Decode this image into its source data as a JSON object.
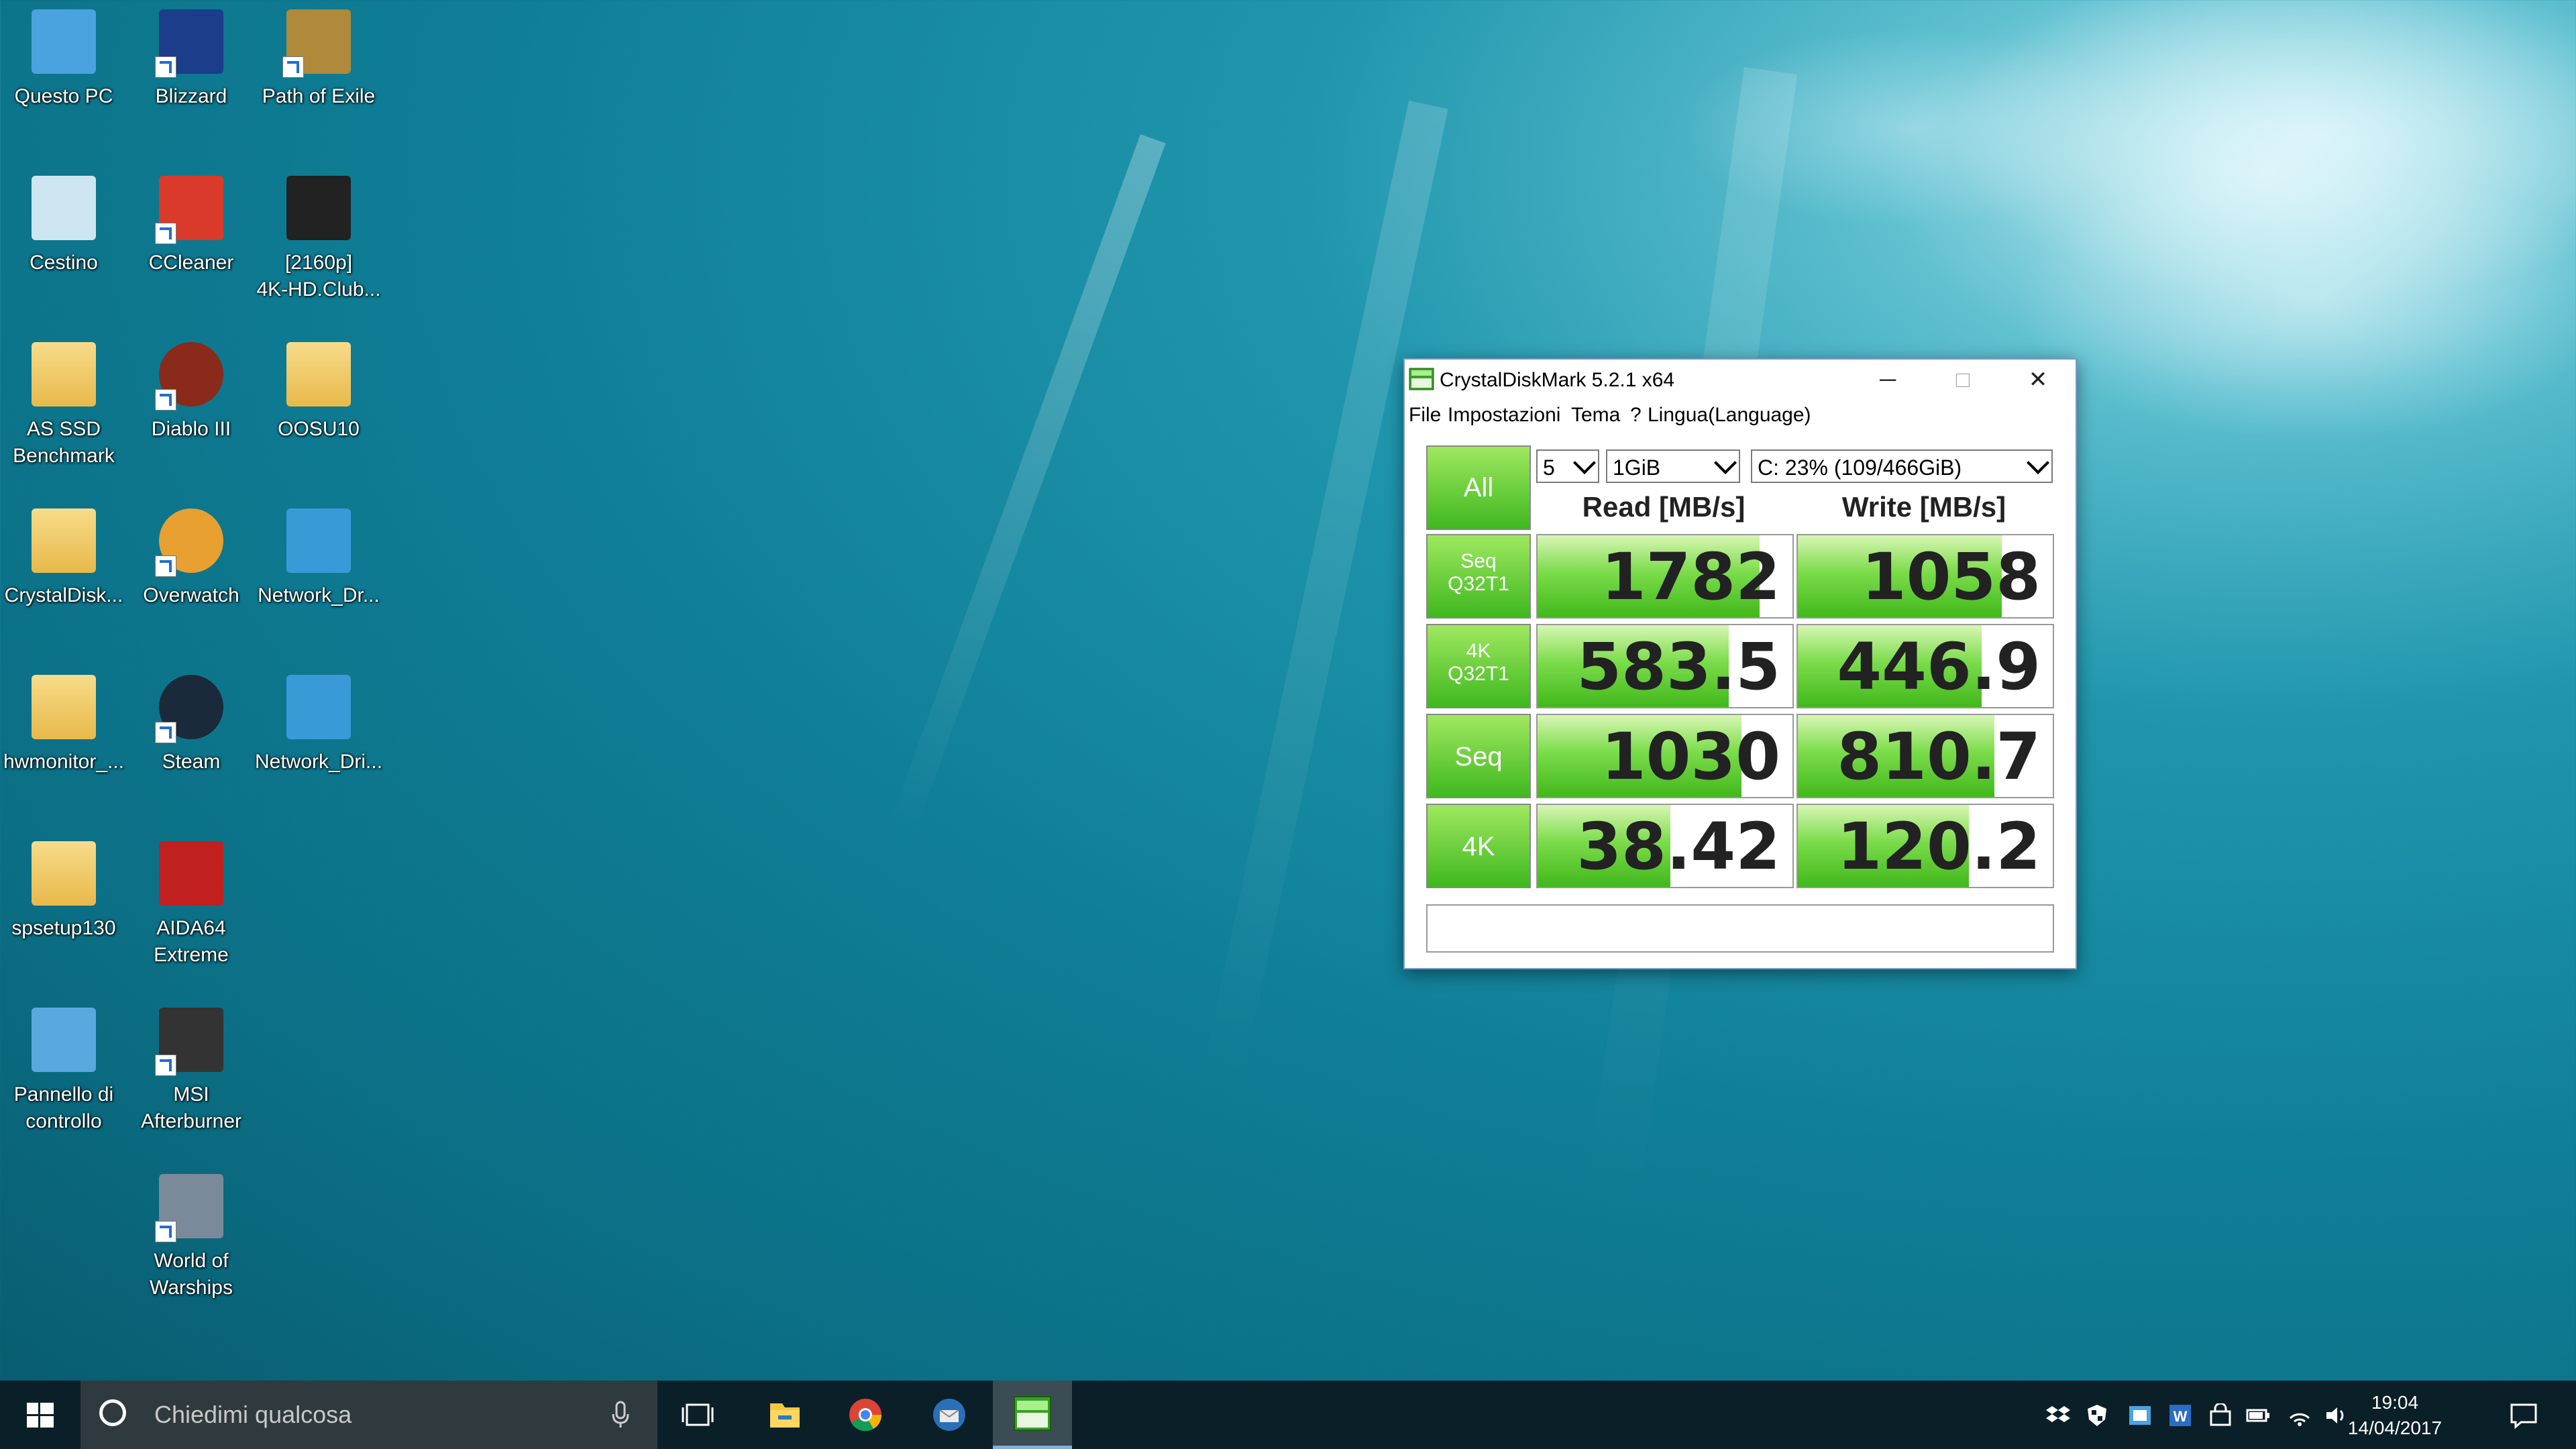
{
  "desktop": {
    "icons": [
      {
        "label": "Questo PC"
      },
      {
        "label": "Blizzard"
      },
      {
        "label": "Path of Exile"
      },
      {
        "label": "Cestino"
      },
      {
        "label": "CCleaner"
      },
      {
        "label": "[2160p]\n4K-HD.Club..."
      },
      {
        "label": "AS SSD\nBenchmark"
      },
      {
        "label": "Diablo III"
      },
      {
        "label": "OOSU10"
      },
      {
        "label": "CrystalDisk..."
      },
      {
        "label": "Overwatch"
      },
      {
        "label": "Network_Dr..."
      },
      {
        "label": "hwmonitor_..."
      },
      {
        "label": "Steam"
      },
      {
        "label": "Network_Dri..."
      },
      {
        "label": "spsetup130"
      },
      {
        "label": "AIDA64\nExtreme"
      },
      {
        "label": "Pannello di\ncontrollo"
      },
      {
        "label": "MSI\nAfterburner"
      },
      {
        "label": "World of\nWarships"
      }
    ]
  },
  "window": {
    "title": "CrystalDiskMark 5.2.1 x64",
    "controls": {
      "minimize": "─",
      "maximize": "□",
      "close": "✕"
    },
    "menu": [
      "File",
      "Impostazioni",
      "Tema",
      "?",
      "Lingua(Language)"
    ],
    "all_label": "All",
    "count_select": "5",
    "size_select": "1GiB",
    "drive_select": "C: 23% (109/466GiB)",
    "read_header": "Read [MB/s]",
    "write_header": "Write [MB/s]",
    "rows": [
      {
        "label1": "Seq",
        "label2": "Q32T1",
        "read": "1782",
        "write": "1058",
        "read_frac": 0.87,
        "write_frac": 0.8
      },
      {
        "label1": "4K",
        "label2": "Q32T1",
        "read": "583.5",
        "write": "446.9",
        "read_frac": 0.75,
        "write_frac": 0.72
      },
      {
        "label1": "Seq",
        "label2": "",
        "read": "1030",
        "write": "810.7",
        "read_frac": 0.8,
        "write_frac": 0.77
      },
      {
        "label1": "4K",
        "label2": "",
        "read": "38.42",
        "write": "120.2",
        "read_frac": 0.52,
        "write_frac": 0.67
      }
    ],
    "status_text": ""
  },
  "taskbar": {
    "search_placeholder": "Chiedimi qualcosa",
    "time": "19:04",
    "date": "14/04/2017"
  }
}
